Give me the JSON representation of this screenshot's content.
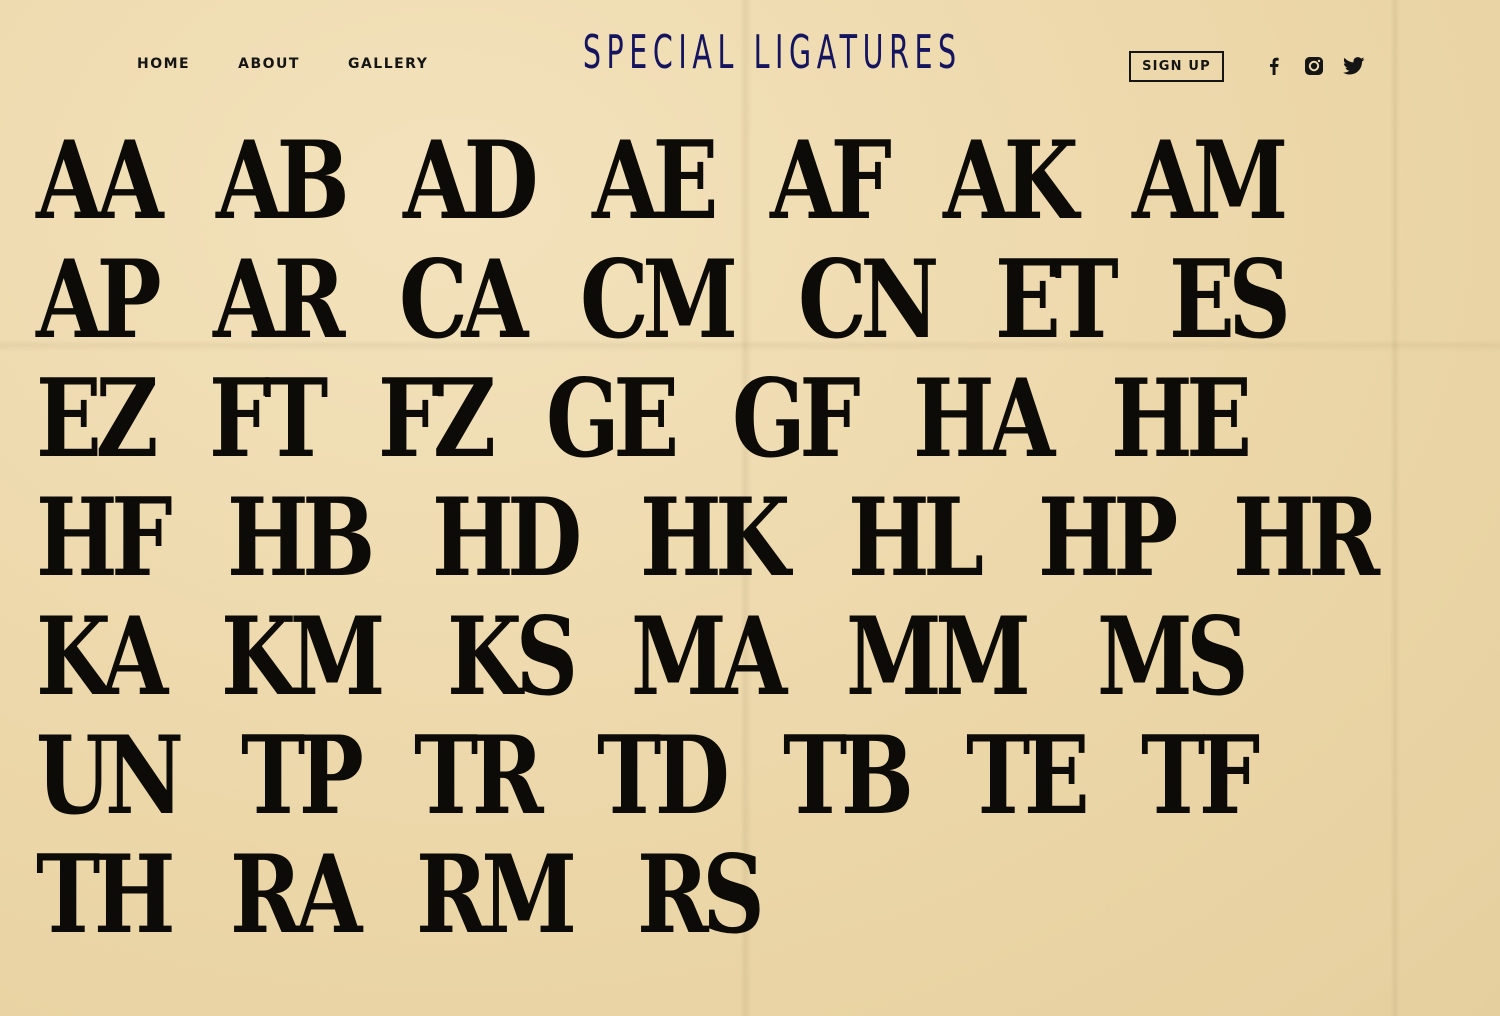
{
  "nav": {
    "items": [
      {
        "label": "HOME"
      },
      {
        "label": "ABOUT"
      },
      {
        "label": "GALLERY"
      }
    ]
  },
  "brand": {
    "title": "SPECIAL LIGATURES",
    "color": "#15145e"
  },
  "header": {
    "signup_label": "SIGN UP"
  },
  "social": {
    "icons": [
      "facebook-icon",
      "instagram-icon",
      "twitter-icon"
    ]
  },
  "ligatures": [
    "AA",
    "AB",
    "AD",
    "AE",
    "AF",
    "AK",
    "AM",
    "AP",
    "AR",
    "CA",
    "CM",
    "CN",
    "ET",
    "ES",
    "EZ",
    "FT",
    "FZ",
    "GE",
    "GF",
    "HA",
    "HE",
    "HF",
    "HB",
    "HD",
    "HK",
    "HL",
    "HP",
    "HR",
    "KA",
    "KM",
    "KS",
    "MA",
    "MM",
    "MS",
    "UN",
    "TP",
    "TR",
    "TD",
    "TB",
    "TE",
    "TF",
    "TH",
    "RA",
    "RM",
    "RS"
  ],
  "colors": {
    "background": "#edd9ad",
    "text": "#0d0b08",
    "brand": "#15145e"
  }
}
